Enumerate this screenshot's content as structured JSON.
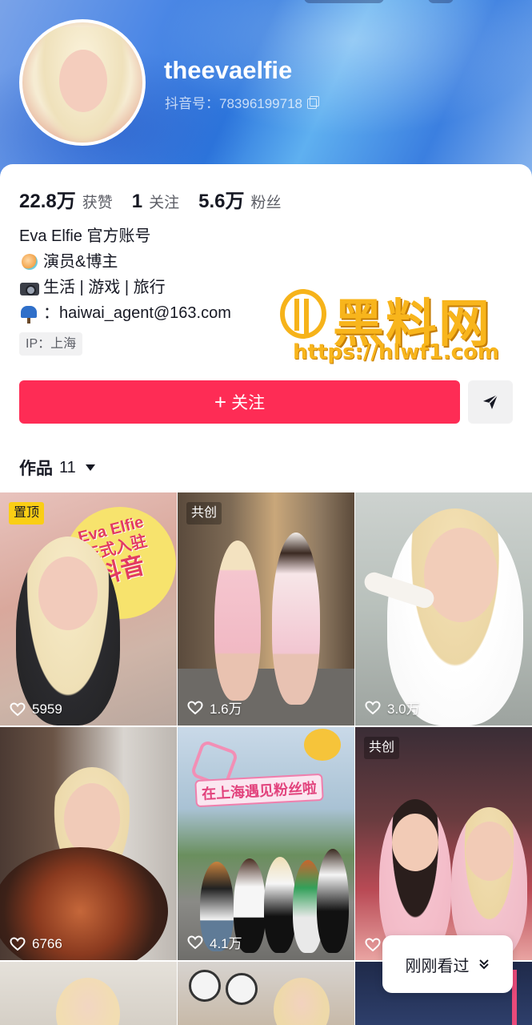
{
  "profile": {
    "username": "theevaelfie",
    "douyin_id": "抖音号：78396199718",
    "stats": [
      {
        "value": "22.8万",
        "label": "获赞"
      },
      {
        "value": "1",
        "label": "关注"
      },
      {
        "value": "5.6万",
        "label": "粉丝"
      }
    ],
    "bio": [
      {
        "icon": "none",
        "text": "Eva Elfie 官方账号"
      },
      {
        "icon": "fairy-emoji",
        "text": "演员&博主"
      },
      {
        "icon": "camera-emoji",
        "text": "生活 | 游戏 | 旅行"
      },
      {
        "icon": "mailbox-emoji",
        "text": "：haiwai_agent@163.com"
      }
    ],
    "ip": "IP：上海"
  },
  "watermark": {
    "title": "黑料网",
    "url": "https://hlwf1.com"
  },
  "actions": {
    "follow_label": "关注",
    "follow_color": "#fe2c55"
  },
  "works": {
    "tab_label": "作品",
    "count": "11"
  },
  "videos": [
    {
      "badge": "置顶",
      "likes": "5959"
    },
    {
      "badge": "共创",
      "likes": "1.6万"
    },
    {
      "badge": "",
      "likes": "3.0万"
    },
    {
      "badge": "",
      "likes": "6766"
    },
    {
      "badge": "",
      "likes": "4.1万",
      "overlay_text": "在上海遇见粉丝啦"
    },
    {
      "badge": "共创",
      "likes": ""
    }
  ],
  "video1_overlay": {
    "line1": "Eva Elfie",
    "line2": "正式入驻",
    "line3": "抖音"
  },
  "recent": {
    "label": "刚刚看过"
  }
}
